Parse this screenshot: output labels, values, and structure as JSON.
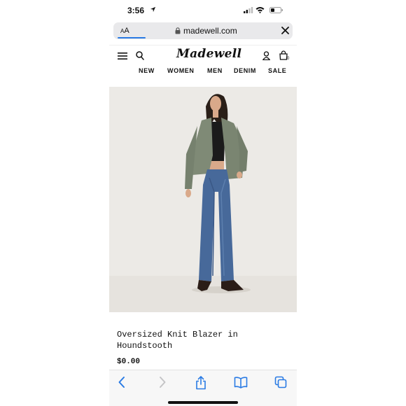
{
  "status_bar": {
    "time": "3:56"
  },
  "browser": {
    "text_size_label_small": "A",
    "text_size_label_large": "A",
    "url": "madewell.com"
  },
  "site": {
    "logo": "Madewell",
    "bag_count": "0",
    "nav": [
      "NEW",
      "WOMEN",
      "MEN",
      "DENIM",
      "SALE"
    ]
  },
  "product": {
    "name": "Oversized Knit Blazer in Houndstooth",
    "price": "$0.00"
  },
  "colors": {
    "accent": "#2a7be4",
    "toolbar_icons": "#2a7be4",
    "image_bg": "#eceae6"
  }
}
